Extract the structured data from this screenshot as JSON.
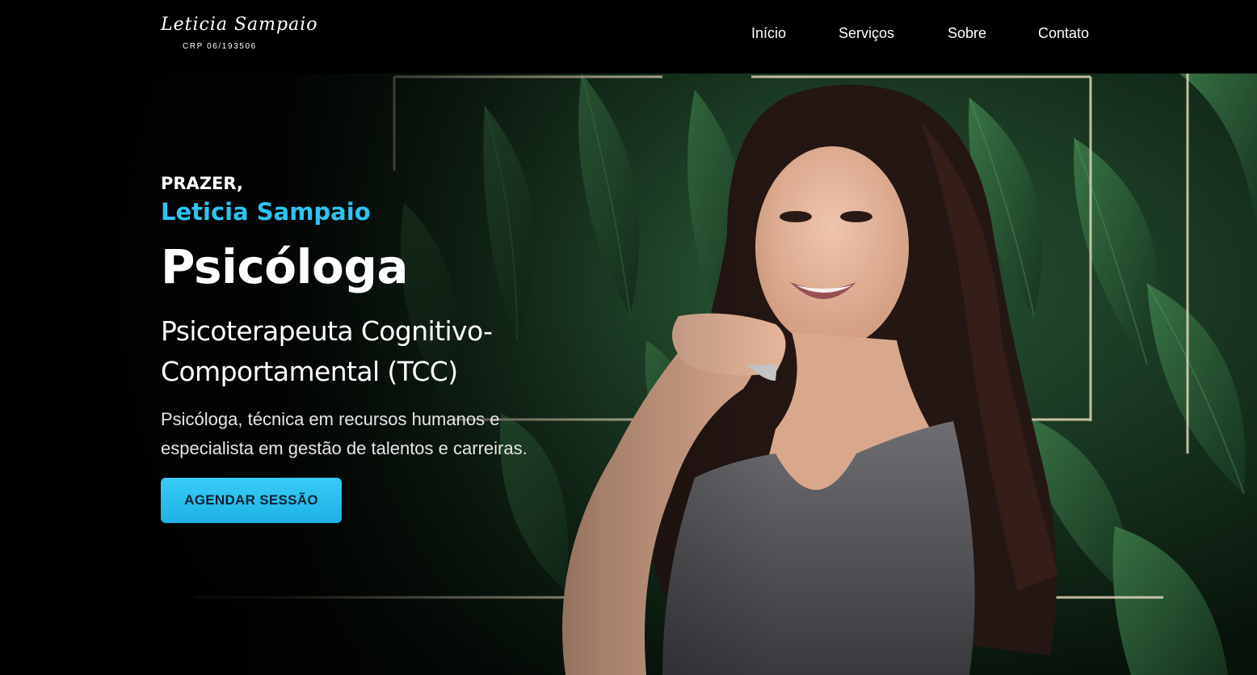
{
  "brand": {
    "name": "Leticia Sampaio",
    "crp": "CRP 06/193506"
  },
  "nav": {
    "items": [
      "Início",
      "Serviços",
      "Sobre",
      "Contato"
    ]
  },
  "hero": {
    "greeting": "PRAZER,",
    "name": "Leticia Sampaio",
    "title": "Psicóloga",
    "subtitle": "Psicoterapeuta Cognitivo-Comportamental (TCC)",
    "description": "Psicóloga, técnica em recursos humanos e especialista em gestão de talentos e carreiras.",
    "cta_label": "AGENDAR SESSÃO"
  },
  "colors": {
    "accent": "#2dc3f2",
    "background": "#000000",
    "foliage": "#1f4a2c"
  }
}
